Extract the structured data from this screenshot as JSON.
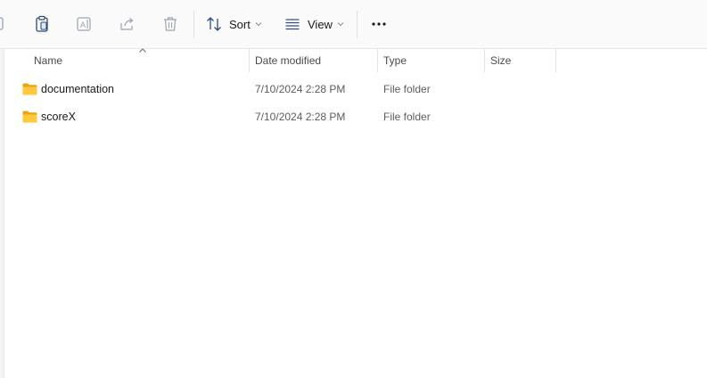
{
  "toolbar": {
    "sort_label": "Sort",
    "view_label": "View",
    "icons": [
      "new-icon",
      "paste-icon",
      "rename-icon",
      "share-icon",
      "delete-icon",
      "sort-icon",
      "view-icon",
      "more-icon"
    ]
  },
  "columns": {
    "name": "Name",
    "date_modified": "Date modified",
    "type": "Type",
    "size": "Size",
    "sorted_by": "Name",
    "sort_direction": "ascending"
  },
  "files": [
    {
      "name": "documentation",
      "date_modified": "7/10/2024 2:28 PM",
      "type": "File folder",
      "size": ""
    },
    {
      "name": "scoreX",
      "date_modified": "7/10/2024 2:28 PM",
      "type": "File folder",
      "size": ""
    }
  ],
  "colors": {
    "folder": "#FFC83D",
    "folder_dark": "#E8A317",
    "icon_disabled": "#9aa4b6",
    "icon_enabled": "#2b4a7a"
  }
}
